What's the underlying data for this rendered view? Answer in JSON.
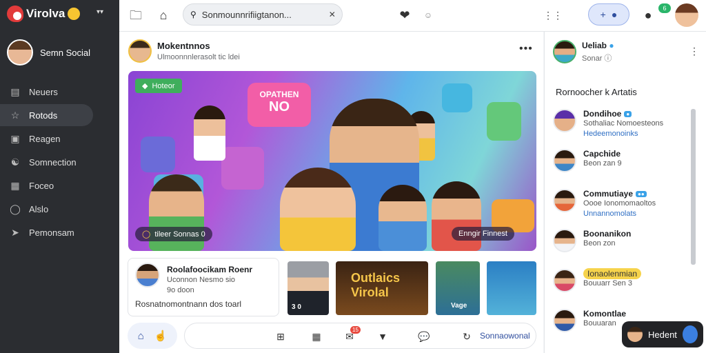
{
  "app": {
    "brand": "Virolva"
  },
  "user": {
    "name": "Semn Social"
  },
  "sidebar": {
    "items": [
      {
        "label": "Neuers",
        "icon": "inbox-icon"
      },
      {
        "label": "Rotods",
        "icon": "star-icon",
        "active": true
      },
      {
        "label": "Reagen",
        "icon": "browser-icon"
      },
      {
        "label": "Somnection",
        "icon": "people-icon"
      },
      {
        "label": "Foceo",
        "icon": "image-icon"
      },
      {
        "label": "Alslo",
        "icon": "clock-icon"
      },
      {
        "label": "Pemonsam",
        "icon": "pin-icon"
      }
    ]
  },
  "topbar": {
    "search_value": "Sonmounnrifiigtanon...",
    "badge": "6"
  },
  "post": {
    "author": "Mokentnnos",
    "subtitle": "Ulmoonnnlerasolt tic ldei",
    "hero_tag": "Hoteor",
    "hero_bubble_top": "OPATHEN",
    "hero_bubble_main": "NO",
    "hero_chip_left": "tileer Sonnas 0",
    "hero_chip_right": "Enngir Finnest"
  },
  "card": {
    "title": "Roolafoocikam Roenr",
    "sub": "Uconnon Nesmo sio",
    "meta": "9o doon",
    "footer": "Rosnatnomontnann dos toarl"
  },
  "thumbs": {
    "t1_label": "3 0",
    "t2_label": "Outlaics Virolal",
    "t3_label": "Vage"
  },
  "actions": {
    "badge_a": "15",
    "label": "Sonnaowonal"
  },
  "rpanel": {
    "me_name": "Ueliab",
    "me_status": "Sonar",
    "title": "Rornoocher k Artatis",
    "items": [
      {
        "line1": "Dondihoe",
        "line2": "Sothaliac  Nomoesteons",
        "line3": "Hedeemonoinks"
      },
      {
        "line1": "Capchide",
        "line2": "Beon zan 9"
      },
      {
        "line1": "Commutiaye",
        "line2": "Oooe Ionomomaoltos",
        "line3": "Unnannomolats"
      },
      {
        "line1": "Boonanikon",
        "line2": "Beon zon"
      },
      {
        "line1": "Ionaolenmian",
        "line2": "Bouuarr Sen 3"
      },
      {
        "line1": "Komontlae",
        "line2": "Bouuaran"
      }
    ]
  },
  "chat": {
    "label": "Hedent"
  }
}
